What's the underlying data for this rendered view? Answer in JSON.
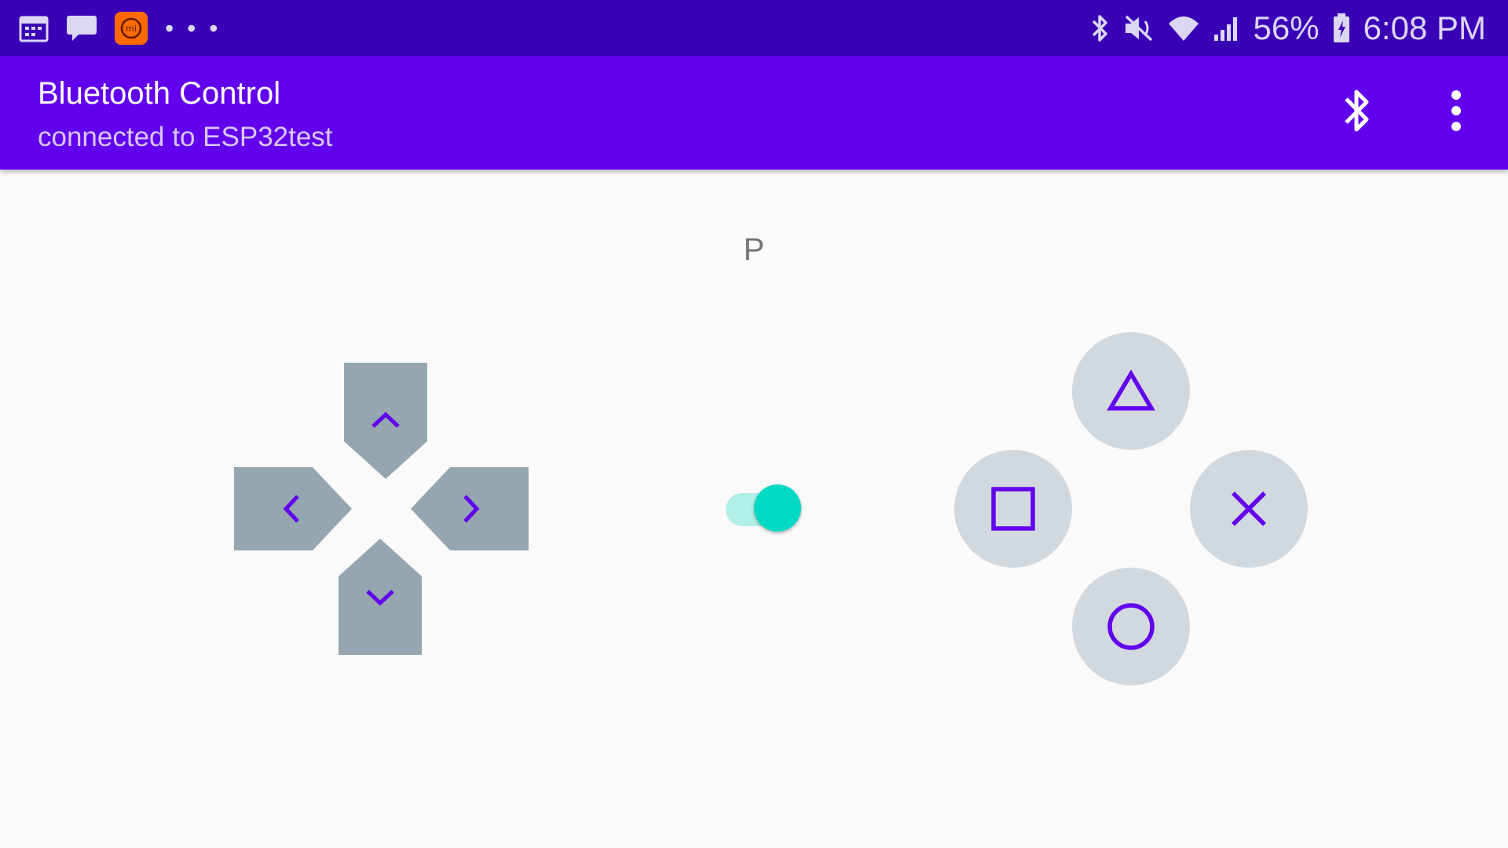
{
  "status_bar": {
    "battery_percent": "56%",
    "time": "6:08 PM",
    "left_icons": [
      "calendar-icon",
      "chat-icon",
      "mi-icon",
      "more-notifications-icon"
    ],
    "right_icons": [
      "bluetooth-icon",
      "vibrate-icon",
      "wifi-icon",
      "signal-icon",
      "battery-icon"
    ],
    "background_color": "#3a00b6"
  },
  "app_bar": {
    "title": "Bluetooth Control",
    "subtitle": "connected to ESP32test",
    "actions": [
      "bluetooth-icon",
      "overflow-menu-icon"
    ],
    "background_color": "#6200ee"
  },
  "controller": {
    "mode_label": "P",
    "dpad": [
      "up",
      "left",
      "right",
      "down"
    ],
    "toggle": {
      "on": true,
      "color": "#03dac5"
    },
    "face_buttons": [
      "triangle",
      "square",
      "cross",
      "circle"
    ],
    "accent_color": "#6200ee",
    "button_color": "#d1d8de",
    "dpad_color": "#95a6b0"
  }
}
